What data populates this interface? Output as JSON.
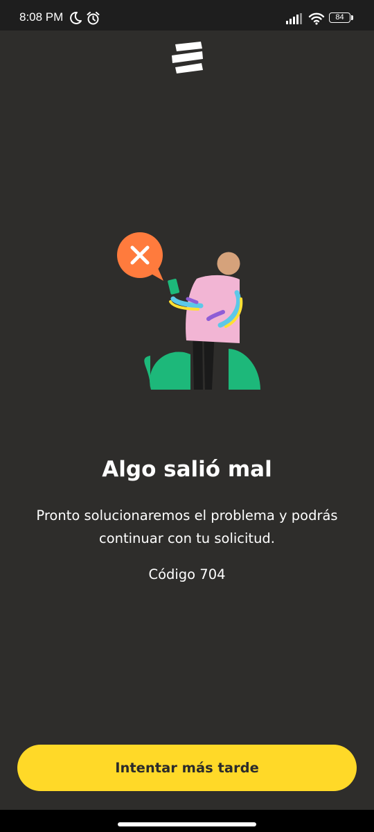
{
  "status_bar": {
    "time": "8:08 PM",
    "battery_level": "84",
    "icons": [
      "moon-icon",
      "alarm-icon",
      "signal-icon",
      "wifi-icon",
      "battery-icon"
    ]
  },
  "app": {
    "logo_icon": "brand-logo-icon"
  },
  "illustration": {
    "icon": "error-person-illustration",
    "badge_icon": "close-icon"
  },
  "error": {
    "title": "Algo salió mal",
    "message": "Pronto solucionaremos el problema y podrás continuar con tu solicitud.",
    "code": "Código 704"
  },
  "actions": {
    "retry_label": "Intentar más tarde"
  },
  "colors": {
    "background": "#2e2d2b",
    "status_bar": "#1e1e1e",
    "accent": "#ffd928",
    "error_badge": "#ff7b3d",
    "plant": "#1db87a"
  }
}
